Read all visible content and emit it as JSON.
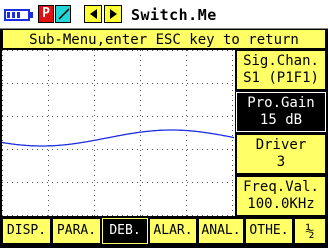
{
  "titlebar": {
    "app_name": "Switch.Me",
    "record_button_label": "P",
    "battery_icon": "battery-icon",
    "colors": {
      "record": "#e01010",
      "tool": "#22d6d6",
      "nav": "#ffff33",
      "battery": "#1c2fe0"
    }
  },
  "banner": {
    "text": "Sub-Menu,enter ESC key to return"
  },
  "plot": {
    "grid": true,
    "trace_color": "#1c2fe0",
    "waveform": "sine"
  },
  "side_menu": [
    {
      "line1": "Sig.Chan.",
      "line2": "S1 (P1F1)",
      "selected": false
    },
    {
      "line1": "Pro.Gain",
      "line2": "15 dB",
      "selected": true
    },
    {
      "line1": "Driver",
      "line2": "3",
      "selected": false
    },
    {
      "line1": "Freq.Val.",
      "line2": "100.0KHz",
      "selected": false
    }
  ],
  "bottom_menu": [
    {
      "label": "DISP.",
      "active": false
    },
    {
      "label": "PARA.",
      "active": false
    },
    {
      "label": "DEB.",
      "active": true
    },
    {
      "label": "ALAR.",
      "active": false
    },
    {
      "label": "ANAL.",
      "active": false
    },
    {
      "label": "OTHE.",
      "active": false
    },
    {
      "label": "½",
      "active": false
    }
  ],
  "colors": {
    "accent_yellow": "#ffff66",
    "background": "#000000"
  }
}
